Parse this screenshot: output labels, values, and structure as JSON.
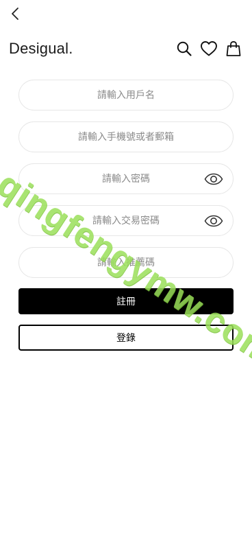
{
  "header": {
    "back_icon": "chevron-left-icon",
    "brand": "Desigual.",
    "icons": [
      "search-icon",
      "heart-icon",
      "shopping-bag-icon"
    ]
  },
  "form": {
    "username_placeholder": "請輸入用戶名",
    "contact_placeholder": "請輸入手機號或者郵箱",
    "password_placeholder": "請輸入密碼",
    "trade_password_placeholder": "請輸入交易密碼",
    "referral_placeholder": "請輸入推薦碼",
    "eye_icon": "eye-icon"
  },
  "buttons": {
    "register_label": "註冊",
    "login_label": "登錄"
  },
  "watermark": {
    "text": "qingfengymw.com",
    "color": "#9be05a"
  }
}
